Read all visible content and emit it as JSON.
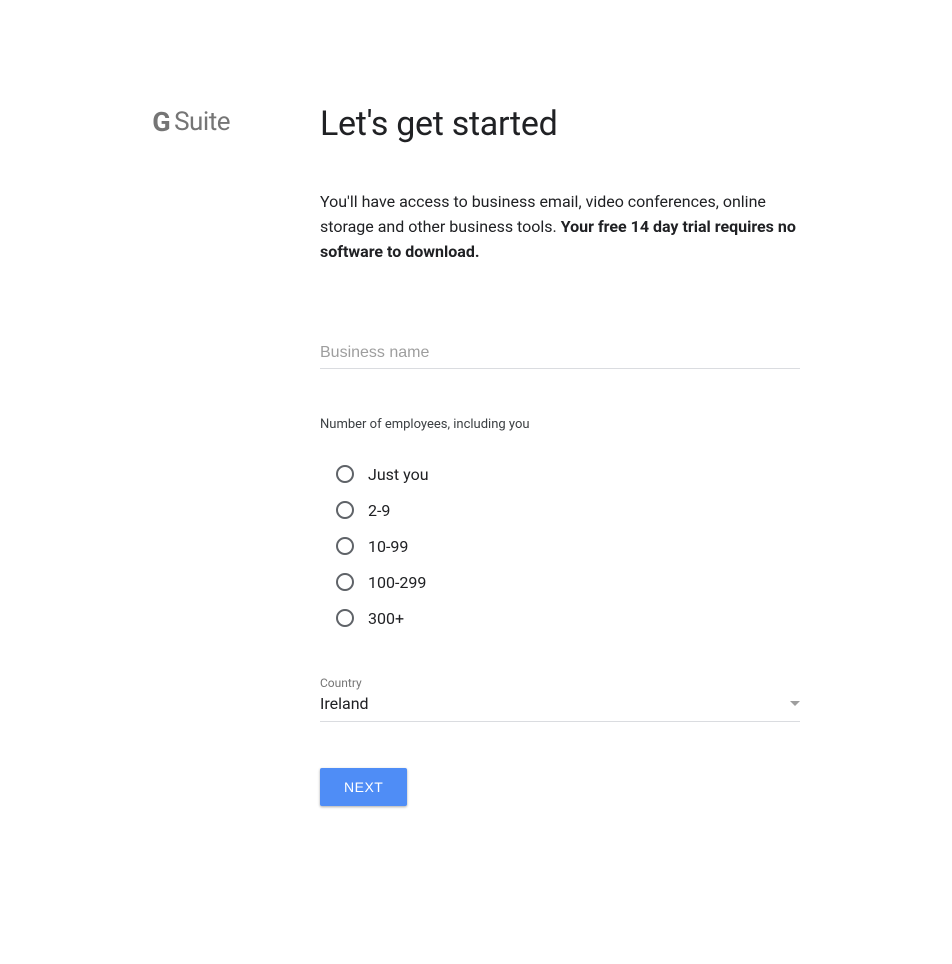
{
  "logo": {
    "g": "G",
    "suite": "Suite"
  },
  "heading": "Let's get started",
  "subtitle": {
    "lead": "You'll have access to business email, video conferences, online storage and other business tools. ",
    "bold": "Your free 14 day trial requires no software to download."
  },
  "business_name": {
    "placeholder": "Business name",
    "value": ""
  },
  "employees": {
    "label": "Number of employees, including you",
    "options": [
      "Just you",
      "2-9",
      "10-99",
      "100-299",
      "300+"
    ]
  },
  "country": {
    "label": "Country",
    "value": "Ireland"
  },
  "next_label": "NEXT"
}
